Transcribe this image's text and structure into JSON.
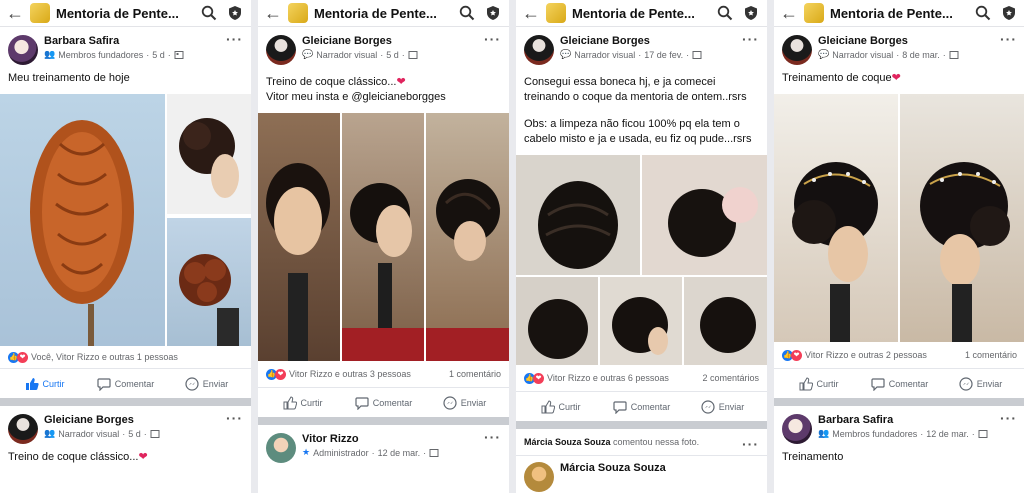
{
  "group_title": "Mentoria de Pente...",
  "columns": [
    {
      "post": {
        "author": "Barbara Safira",
        "role": "Membros fundadores",
        "time": "5 d",
        "text": [
          "Meu treinamento de hoje"
        ],
        "reactions_text": "Você, Vitor Rizzo e outras 1 pessoas",
        "comments": ""
      },
      "actions": {
        "like": "Curtir",
        "comment": "Comentar",
        "send": "Enviar"
      },
      "next": {
        "author": "Gleiciane Borges",
        "role": "Narrador visual",
        "time": "5 d",
        "text": "Treino de coque clássico..."
      }
    },
    {
      "post": {
        "author": "Gleiciane Borges",
        "role": "Narrador visual",
        "time": "5 d",
        "text": [
          "Treino de coque clássico...",
          "Vitor meu insta e @gleicianeborgges"
        ],
        "reactions_text": "Vitor Rizzo e outras 3 pessoas",
        "comments": "1 comentário"
      },
      "actions": {
        "like": "Curtir",
        "comment": "Comentar",
        "send": "Enviar"
      },
      "next": {
        "author": "Vitor Rizzo",
        "role": "Administrador",
        "time": "12 de mar."
      }
    },
    {
      "post": {
        "author": "Gleiciane Borges",
        "role": "Narrador visual",
        "time": "17 de fev.",
        "text": [
          "Consegui essa boneca hj, e ja comecei",
          "treinando o coque da mentoria de ontem..rsrs",
          "",
          "Obs: a limpeza não ficou 100% pq ela tem o",
          "cabelo misto e ja e usada, eu fiz oq pude...rsrs"
        ],
        "reactions_text": "Vitor Rizzo e outras 6 pessoas",
        "comments": "2 comentários"
      },
      "actions": {
        "like": "Curtir",
        "comment": "Comentar",
        "send": "Enviar"
      },
      "shared": {
        "name": "Márcia Souza Souza",
        "action": "comentou nessa foto."
      },
      "next": {
        "author": "Márcia Souza Souza"
      }
    },
    {
      "post": {
        "author": "Gleiciane Borges",
        "role": "Narrador visual",
        "time": "8 de mar.",
        "text": [
          "Treinamento de coque"
        ],
        "reactions_text": "Vitor Rizzo e outras 2 pessoas",
        "comments": "1 comentário"
      },
      "actions": {
        "like": "Curtir",
        "comment": "Comentar",
        "send": "Enviar"
      },
      "next": {
        "author": "Barbara Safira",
        "role": "Membros fundadores",
        "time": "12 de mar.",
        "text": "Treinamento"
      }
    }
  ],
  "colors": {
    "like_blue": "#1877f2",
    "love_red": "#f33e58",
    "heart": "#e0245e"
  }
}
